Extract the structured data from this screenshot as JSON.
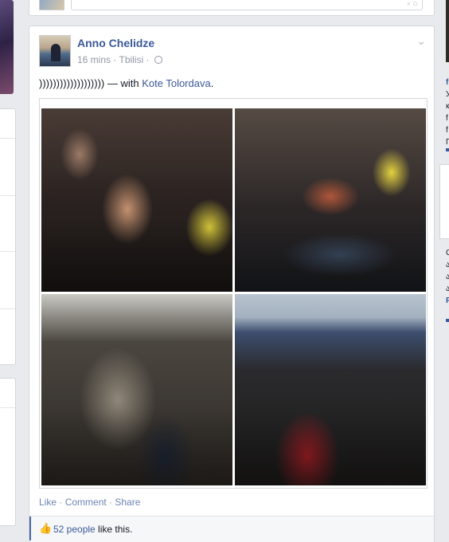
{
  "previous_post": {
    "icons": "▫ ○"
  },
  "post": {
    "author": "Anno Chelidze",
    "time": "16 mins",
    "location": "Tbilisi",
    "separator": " · ",
    "text_prefix": "))))))))))))))))))) — with ",
    "tagged_person": "Kote Tolordava",
    "text_suffix": ".",
    "chevron": "⌄",
    "photos": [
      "photo-1",
      "photo-2",
      "photo-3",
      "photo-4"
    ],
    "actions": {
      "like": "Like",
      "comment": "Comment",
      "share": "Share",
      "dot": " · "
    },
    "likes": {
      "count_text": "52 people",
      "suffix": " like this.",
      "icon": "👍"
    }
  },
  "right_sidebar": {
    "lines": [
      "f",
      "У",
      "к",
      "f",
      "f",
      "П"
    ],
    "lines2": [
      "C",
      "ა",
      "ა",
      "ა",
      "F"
    ]
  },
  "colors": {
    "link": "#3b5998",
    "background": "#e9eaed",
    "meta": "#9197a3"
  }
}
